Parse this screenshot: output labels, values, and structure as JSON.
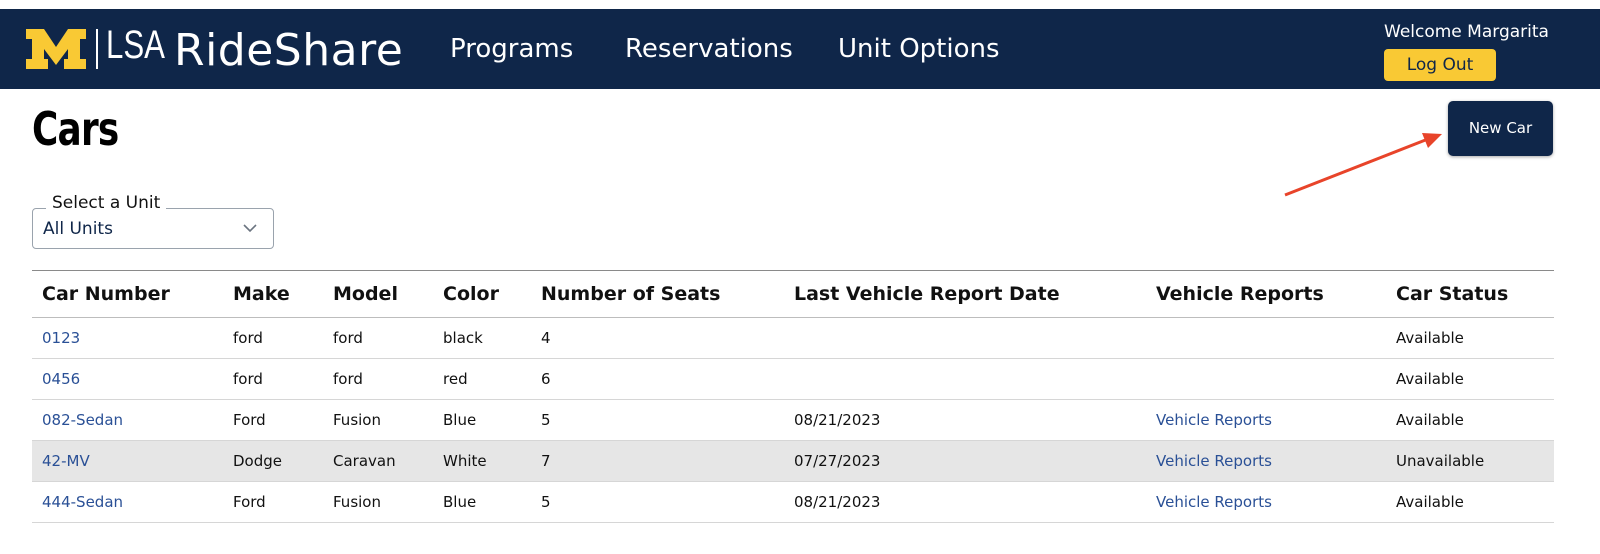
{
  "header": {
    "logo_lsa": "LSA",
    "brand": "RideShare",
    "nav": [
      "Programs",
      "Reservations",
      "Unit Options"
    ],
    "welcome": "Welcome Margarita",
    "logout_label": "Log Out"
  },
  "page": {
    "title": "Cars",
    "new_car_label": "New Car"
  },
  "unit_filter": {
    "legend": "Select a Unit",
    "value": "All Units"
  },
  "table": {
    "columns": [
      "Car Number",
      "Make",
      "Model",
      "Color",
      "Number of Seats",
      "Last Vehicle Report Date",
      "Vehicle Reports",
      "Car Status"
    ],
    "rows": [
      {
        "car_number": "0123",
        "make": "ford",
        "model": "ford",
        "color": "black",
        "seats": "4",
        "last_report": "",
        "reports": "",
        "status": "Available"
      },
      {
        "car_number": "0456",
        "make": "ford",
        "model": "ford",
        "color": "red",
        "seats": "6",
        "last_report": "",
        "reports": "",
        "status": "Available"
      },
      {
        "car_number": "082-Sedan",
        "make": "Ford",
        "model": "Fusion",
        "color": "Blue",
        "seats": "5",
        "last_report": "08/21/2023",
        "reports": "Vehicle Reports",
        "status": "Available"
      },
      {
        "car_number": "42-MV",
        "make": "Dodge",
        "model": "Caravan",
        "color": "White",
        "seats": "7",
        "last_report": "07/27/2023",
        "reports": "Vehicle Reports",
        "status": "Unavailable"
      },
      {
        "car_number": "444-Sedan",
        "make": "Ford",
        "model": "Fusion",
        "color": "Blue",
        "seats": "5",
        "last_report": "08/21/2023",
        "reports": "Vehicle Reports",
        "status": "Available"
      }
    ]
  },
  "colors": {
    "navy": "#0f2649",
    "maize": "#f9c934",
    "available": "#2e7d32",
    "unavailable": "#b0251b",
    "link": "#2a5096",
    "annotation_arrow": "#e8442a"
  },
  "icons": {
    "logo": "block-m-logo",
    "select": "chevron-down-icon",
    "annotation": "arrow-annotation"
  }
}
